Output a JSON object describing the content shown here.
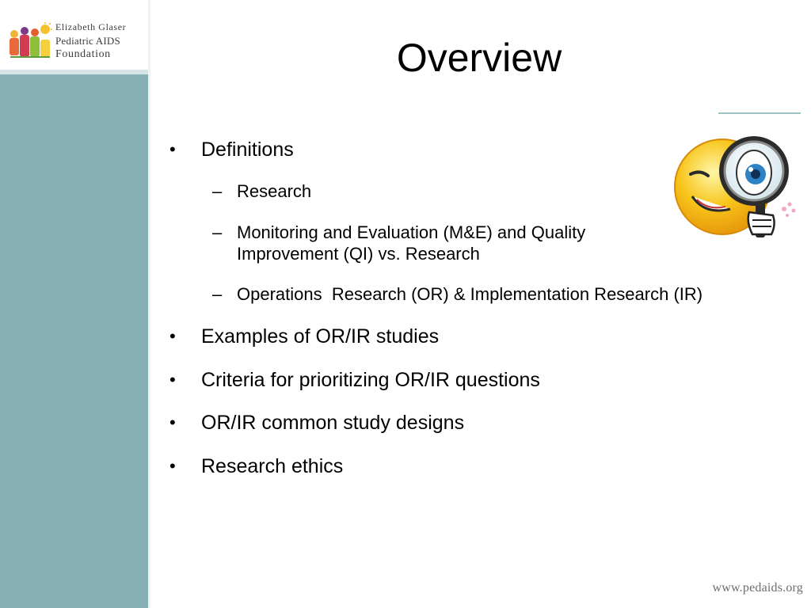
{
  "logo": {
    "line1": "Elizabeth Glaser",
    "line2": "Pediatric AIDS",
    "line3": "Foundation"
  },
  "slide": {
    "title": "Overview",
    "bullets": [
      {
        "text": "Definitions",
        "children": [
          "Research",
          "Monitoring and Evaluation (M&E) and Quality Improvement (QI) vs. Research",
          "Operations  Research (OR) & Implementation Research (IR)"
        ]
      },
      {
        "text": "Examples of OR/IR studies"
      },
      {
        "text": "Criteria for prioritizing OR/IR questions"
      },
      {
        "text": "OR/IR common study designs"
      },
      {
        "text": "Research ethics"
      }
    ]
  },
  "footer": {
    "url": "www.pedaids.org"
  },
  "icons": {
    "logo_mark": "children-figures-icon",
    "illustration": "winking-smiley-magnifier-icon"
  },
  "colors": {
    "sidebar": "#86b0b4",
    "accent_rule": "#9ec2c5",
    "emoji_yellow": "#f7c51a"
  }
}
